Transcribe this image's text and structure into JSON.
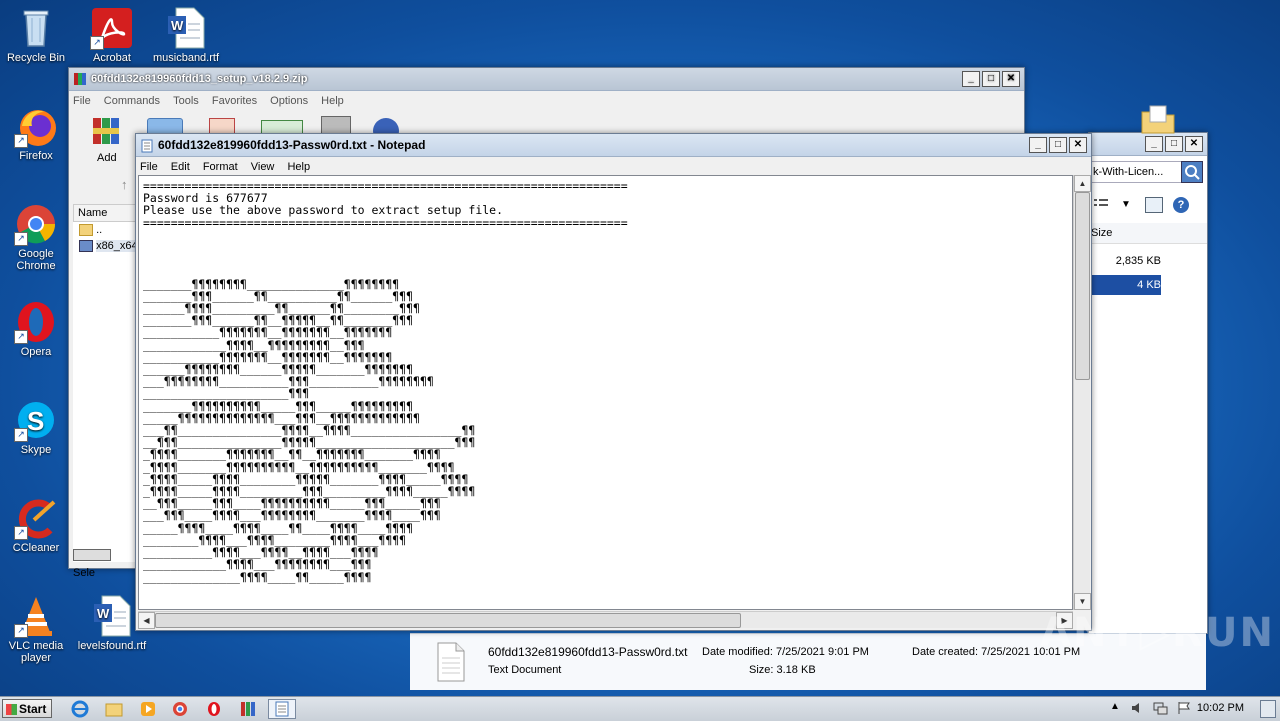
{
  "desktop": {
    "icons": [
      {
        "label": "Recycle Bin"
      },
      {
        "label": "Acrobat"
      },
      {
        "label": "musicband.rtf"
      },
      {
        "label": "Firefox"
      },
      {
        "label": "Google Chrome"
      },
      {
        "label": "Opera"
      },
      {
        "label": "Skype"
      },
      {
        "label": "CCleaner"
      },
      {
        "label": "VLC media player"
      },
      {
        "label": "levelsfound.rtf"
      }
    ]
  },
  "winrar": {
    "title": "60fdd132e819960fdd13_setup_v18.2.9.zip",
    "menu": [
      "File",
      "Commands",
      "Tools",
      "Favorites",
      "Options",
      "Help"
    ],
    "toolbar_add_label": "Add",
    "list_header_name": "Name",
    "rows": [
      "..",
      "x86_x64"
    ],
    "status_text": "Sele"
  },
  "explorer": {
    "search_value": "k-With-Licen...",
    "size_header": "Size",
    "sizes": [
      "2,835 KB",
      "4 KB"
    ],
    "details": {
      "filename": "60fdd132e819960fdd13-Passw0rd.txt",
      "filetype": "Text Document",
      "date_modified": "Date modified: 7/25/2021 9:01 PM",
      "size": "Size: 3.18 KB",
      "date_created": "Date created: 7/25/2021 10:01 PM"
    }
  },
  "notepad": {
    "title": "60fdd132e819960fdd13-Passw0rd.txt - Notepad",
    "menu": [
      "File",
      "Edit",
      "Format",
      "View",
      "Help"
    ],
    "content": "======================================================================\nPassword is 677677\nPlease use the above password to extract setup file.\n======================================================================\n\n\n\n\n_______¶¶¶¶¶¶¶¶______________¶¶¶¶¶¶¶¶\n_______¶¶¶______¶¶__________¶¶______¶¶¶\n______¶¶¶¶_________¶¶______¶¶________¶¶¶\n_______¶¶¶______¶¶__¶¶¶¶¶__¶¶_______¶¶¶\n___________¶¶¶¶¶¶¶__¶¶¶¶¶¶¶__¶¶¶¶¶¶¶\n____________¶¶¶¶__¶¶¶¶¶¶¶¶¶__¶¶¶\n___________¶¶¶¶¶¶¶__¶¶¶¶¶¶¶__¶¶¶¶¶¶¶\n______¶¶¶¶¶¶¶¶______¶¶¶¶¶_______¶¶¶¶¶¶¶\n___¶¶¶¶¶¶¶¶__________¶¶¶__________¶¶¶¶¶¶¶¶\n_____________________¶¶¶\n_______¶¶¶¶¶¶¶¶¶¶_____¶¶¶_____¶¶¶¶¶¶¶¶¶\n_____¶¶¶¶¶¶¶¶¶¶¶¶¶¶___¶¶¶__¶¶¶¶¶¶¶¶¶¶¶¶¶\n___¶¶_______________¶¶¶¶__¶¶¶¶________________¶¶\n__¶¶¶_______________¶¶¶¶¶____________________¶¶¶\n_¶¶¶¶_______¶¶¶¶¶¶¶__¶¶__¶¶¶¶¶¶¶_______¶¶¶¶\n_¶¶¶¶_______¶¶¶¶¶¶¶¶¶¶__¶¶¶¶¶¶¶¶¶¶_______¶¶¶¶\n_¶¶¶¶_____¶¶¶¶________¶¶¶¶¶_______¶¶¶¶_____¶¶¶¶\n_¶¶¶¶_____¶¶¶¶_________¶¶¶_________¶¶¶¶_____¶¶¶¶\n__¶¶¶_____¶¶¶____¶¶¶¶¶¶¶¶¶¶_____¶¶¶_____¶¶¶\n___¶¶¶____¶¶¶¶___¶¶¶¶¶¶¶¶_______¶¶¶¶____¶¶¶\n_____¶¶¶¶____¶¶¶¶____¶¶____¶¶¶¶____¶¶¶¶\n________¶¶¶¶___¶¶¶¶________¶¶¶¶___¶¶¶¶\n__________¶¶¶¶___¶¶¶¶__¶¶¶¶___¶¶¶¶\n____________¶¶¶¶___¶¶¶¶¶¶¶¶___¶¶¶\n______________¶¶¶¶____¶¶_____¶¶¶¶"
  },
  "taskbar": {
    "start_label": "Start",
    "clock": "10:02 PM"
  },
  "watermark": "ANY▷RUN"
}
